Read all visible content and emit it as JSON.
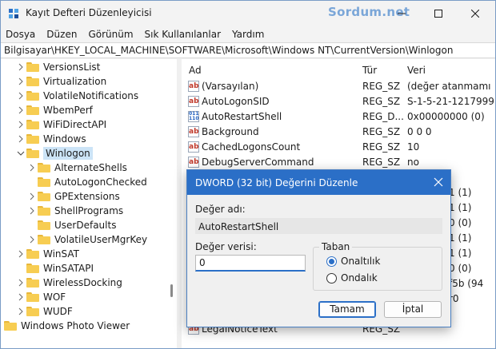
{
  "window": {
    "title": "Kayıt Defteri Düzenleyicisi",
    "watermark": "Sordum.net"
  },
  "menu": {
    "items": [
      {
        "label": "Dosya"
      },
      {
        "label": "Düzen"
      },
      {
        "label": "Görünüm"
      },
      {
        "label": "Sık Kullanılanlar"
      },
      {
        "label": "Yardım"
      }
    ]
  },
  "address": {
    "path": "Bilgisayar\\HKEY_LOCAL_MACHINE\\SOFTWARE\\Microsoft\\Windows NT\\CurrentVersion\\Winlogon"
  },
  "tree": {
    "items": [
      {
        "label": "VersionsList",
        "expanded": false
      },
      {
        "label": "Virtualization",
        "expanded": false
      },
      {
        "label": "VolatileNotifications",
        "expanded": false
      },
      {
        "label": "WbemPerf",
        "expanded": false
      },
      {
        "label": "WiFiDirectAPI",
        "expanded": false
      },
      {
        "label": "Windows",
        "expanded": false
      },
      {
        "label": "Winlogon",
        "expanded": true,
        "selected": true
      },
      {
        "label": "AlternateShells",
        "expanded": false
      },
      {
        "label": "AutoLogonChecked",
        "expanded": false
      },
      {
        "label": "GPExtensions",
        "expanded": false
      },
      {
        "label": "ShellPrograms",
        "expanded": false
      },
      {
        "label": "UserDefaults",
        "expanded": false
      },
      {
        "label": "VolatileUserMgrKey",
        "expanded": false
      },
      {
        "label": "WinSAT",
        "expanded": false
      },
      {
        "label": "WinSATAPI",
        "expanded": false
      },
      {
        "label": "WirelessDocking",
        "expanded": false
      },
      {
        "label": "WOF",
        "expanded": false
      },
      {
        "label": "WUDF",
        "expanded": false
      },
      {
        "label": "Windows Photo Viewer",
        "expanded": false
      }
    ]
  },
  "list": {
    "headers": {
      "name": "Ad",
      "type": "Tür",
      "data": "Veri"
    },
    "rows": [
      {
        "icon": "sz",
        "name": "(Varsayılan)",
        "type": "REG_SZ",
        "data": "(değer atanmamı"
      },
      {
        "icon": "sz",
        "name": "AutoLogonSID",
        "type": "REG_SZ",
        "data": "S-1-5-21-1217999"
      },
      {
        "icon": "dw",
        "name": "AutoRestartShell",
        "type": "REG_D...",
        "data": "0x00000000 (0)"
      },
      {
        "icon": "sz",
        "name": "Background",
        "type": "REG_SZ",
        "data": "0 0 0"
      },
      {
        "icon": "sz",
        "name": "CachedLogonsCount",
        "type": "REG_SZ",
        "data": "10"
      },
      {
        "icon": "sz",
        "name": "DebugServerCommand",
        "type": "REG_SZ",
        "data": "no"
      },
      {
        "icon": "",
        "name": "",
        "type": "",
        "data": "1 (1)"
      },
      {
        "icon": "",
        "name": "",
        "type": "",
        "data": "1 (1)"
      },
      {
        "icon": "",
        "name": "",
        "type": "",
        "data": "0 (0)"
      },
      {
        "icon": "",
        "name": "",
        "type": "",
        "data": "1 (1)"
      },
      {
        "icon": "",
        "name": "",
        "type": "",
        "data": "1 (1)"
      },
      {
        "icon": "",
        "name": "",
        "type": "",
        "data": "0 (0)"
      },
      {
        "icon": "",
        "name": "",
        "type": "",
        "data": "f5b (94"
      },
      {
        "icon": "",
        "name": "",
        "type": "",
        "data": "r0"
      },
      {
        "icon": "",
        "name": "",
        "type": "",
        "data": ""
      },
      {
        "icon": "sz",
        "name": "LegalNoticeText",
        "type": "REG_SZ",
        "data": ""
      }
    ]
  },
  "dialog": {
    "title": "DWORD (32 bit) Değerini Düzenle",
    "name_label": "Değer adı:",
    "name_value": "AutoRestartShell",
    "data_label": "Değer verisi:",
    "data_value": "0",
    "base_label": "Taban",
    "base_options": [
      {
        "label": "Onaltılık",
        "checked": true
      },
      {
        "label": "Ondalık",
        "checked": false
      }
    ],
    "ok_label": "Tamam",
    "cancel_label": "İptal"
  },
  "colors": {
    "accent": "#2b6fc7",
    "folder": "#f7cd52",
    "selection": "#cce4f7",
    "watermark": "#7aa6d8"
  }
}
